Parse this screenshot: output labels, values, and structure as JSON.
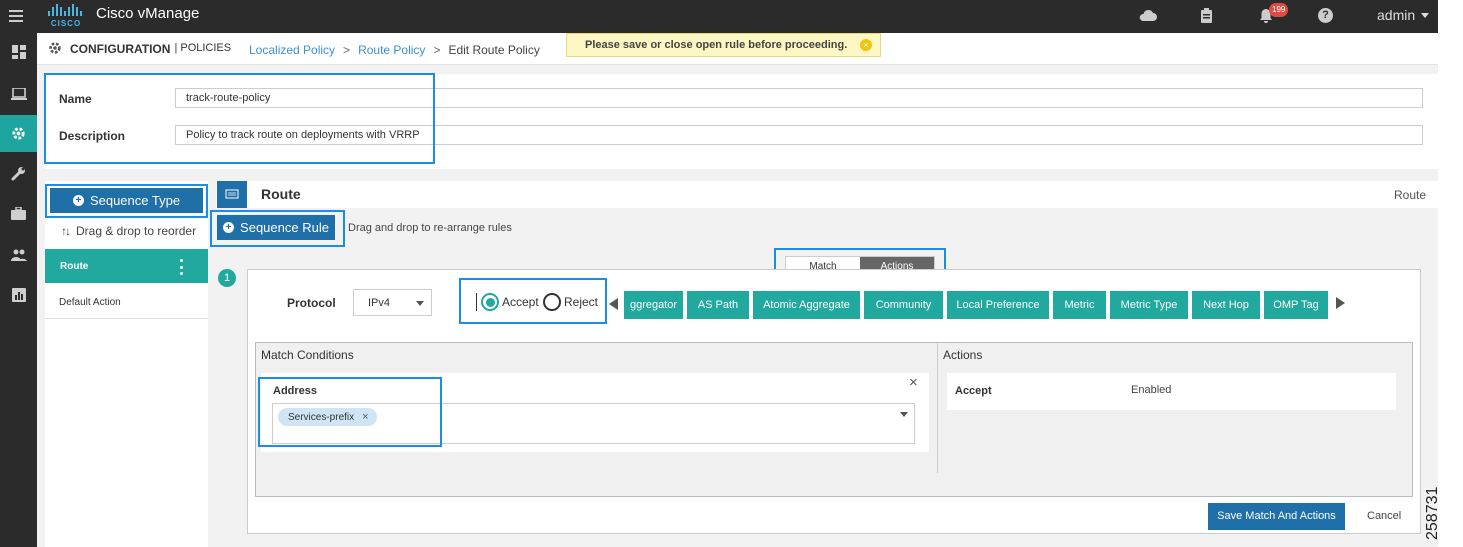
{
  "topbar": {
    "app_title": "Cisco vManage",
    "logo_text": "CISCO",
    "notification_count": "199",
    "user": "admin"
  },
  "header": {
    "section": "CONFIGURATION",
    "subsection": "| POLICIES",
    "breadcrumb": [
      {
        "label": "Localized Policy",
        "link": true
      },
      {
        "label": ">",
        "link": false
      },
      {
        "label": "Route Policy",
        "link": true
      },
      {
        "label": ">",
        "link": false
      },
      {
        "label": "Edit Route Policy",
        "link": false
      }
    ],
    "warning": "Please save or close open rule before proceeding."
  },
  "policy": {
    "name_label": "Name",
    "name_value": "track-route-policy",
    "description_label": "Description",
    "description_value": "Policy to track route on deployments with VRRP"
  },
  "sidebar": {
    "sequence_type_label": "Sequence Type",
    "drag_reorder_label": "Drag & drop to reorder",
    "items": [
      {
        "label": "Route",
        "active": true
      },
      {
        "label": "Default Action",
        "active": false
      }
    ]
  },
  "main": {
    "title": "Route",
    "title_right": "Route",
    "sequence_rule_label": "Sequence Rule",
    "drag_rules_label": "Drag and drop to re-arrange rules",
    "rule_number": "1",
    "toggle": {
      "match_label": "Match",
      "actions_label": "Actions",
      "selected": "Actions"
    },
    "protocol_label": "Protocol",
    "protocol_value": "IPv4",
    "accept_label": "Accept",
    "reject_label": "Reject",
    "selected_action": "Accept",
    "action_tabs": [
      "ggregator",
      "AS Path",
      "Atomic Aggregate",
      "Community",
      "Local Preference",
      "Metric",
      "Metric Type",
      "Next Hop",
      "OMP Tag"
    ],
    "match_conditions_title": "Match Conditions",
    "address_label": "Address",
    "address_chip": "Services-prefix",
    "actions_title": "Actions",
    "actions_rows": [
      {
        "name": "Accept",
        "value": "Enabled"
      }
    ],
    "save_button": "Save Match And Actions",
    "cancel_button": "Cancel"
  },
  "figure_id": "258731",
  "colors": {
    "teal": "#21a89f",
    "blue_button": "#1f6fa8",
    "annotation": "#1a8ee6",
    "topbar": "#2b2b2b"
  }
}
